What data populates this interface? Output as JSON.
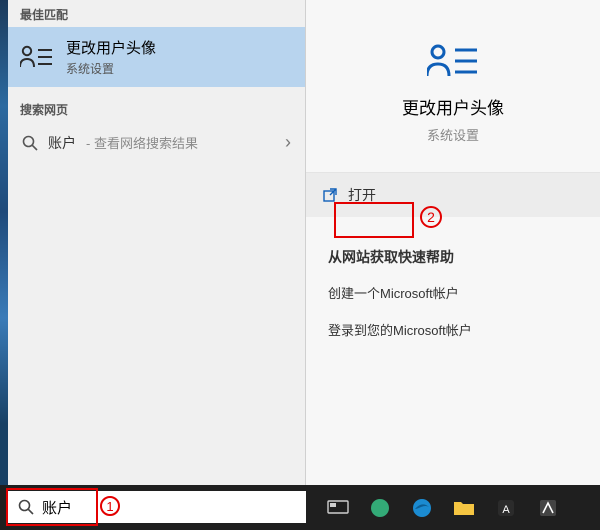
{
  "left": {
    "bestMatchLabel": "最佳匹配",
    "bestMatch": {
      "title": "更改用户头像",
      "subtitle": "系统设置"
    },
    "webLabel": "搜索网页",
    "webItem": {
      "query": "账户",
      "hint": "- 查看网络搜索结果"
    }
  },
  "right": {
    "title": "更改用户头像",
    "subtitle": "系统设置",
    "openLabel": "打开",
    "helpHeader": "从网站获取快速帮助",
    "helpLinks": [
      "创建一个Microsoft帐户",
      "登录到您的Microsoft帐户"
    ]
  },
  "search": {
    "value": "账户"
  },
  "annotations": {
    "one": "1",
    "two": "2"
  }
}
